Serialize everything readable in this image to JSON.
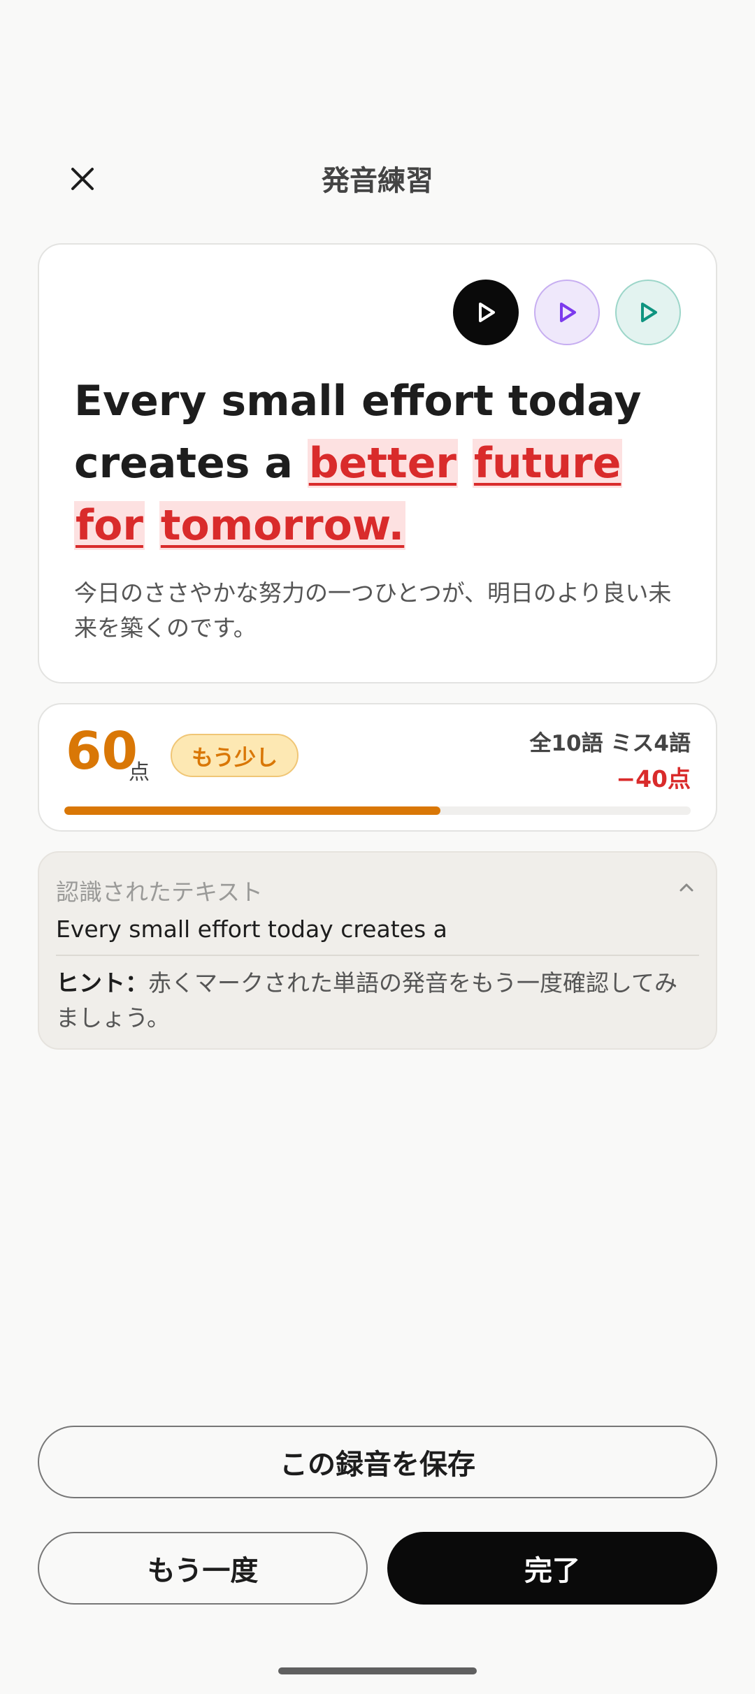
{
  "header": {
    "title": "発音練習",
    "close_icon": "close-icon"
  },
  "sentence_card": {
    "play_buttons": [
      {
        "icon": "play-icon",
        "color": "#0a0a0a"
      },
      {
        "icon": "play-icon",
        "color": "#7c3aed"
      },
      {
        "icon": "play-icon",
        "color": "#0f9480"
      }
    ],
    "words": [
      {
        "text": "Every",
        "missed": false
      },
      {
        "text": "small",
        "missed": false
      },
      {
        "text": "effort",
        "missed": false
      },
      {
        "text": "today",
        "missed": false
      },
      {
        "text": "creates",
        "missed": false
      },
      {
        "text": "a",
        "missed": false
      },
      {
        "text": "better",
        "missed": true
      },
      {
        "text": "future",
        "missed": true
      },
      {
        "text": "for",
        "missed": true
      },
      {
        "text": "tomorrow.",
        "missed": true
      }
    ],
    "translation": "今日のささやかな努力の一つひとつが、明日のより良い未来を築くのです。"
  },
  "score": {
    "value": "60",
    "unit": "点",
    "badge": "もう少し",
    "words_stat": "全10語 ミス4語",
    "penalty": "−40点",
    "progress_fraction": 0.6,
    "accent": "#d97706"
  },
  "recognized": {
    "label": "認識されたテキスト",
    "text": "Every small effort today creates a",
    "hint_label": "ヒント：",
    "hint_text": "赤くマークされた単語の発音をもう一度確認してみましょう。"
  },
  "actions": {
    "save_label": "この録音を保存",
    "retry_label": "もう一度",
    "done_label": "完了"
  }
}
